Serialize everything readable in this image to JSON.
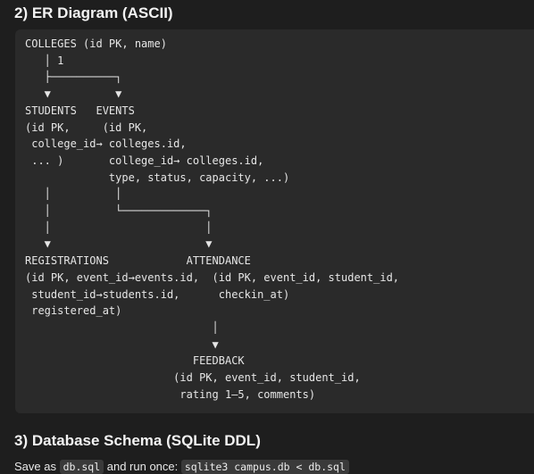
{
  "er_section": {
    "heading": "2) ER Diagram (ASCII)",
    "ascii_lines": [
      "COLLEGES (id PK, name)",
      "   │ 1",
      "   ├──────────┐",
      "   ▼          ▼",
      "STUDENTS   EVENTS",
      "(id PK,     (id PK,",
      " college_id→ colleges.id,",
      " ... )       college_id→ colleges.id,",
      "             type, status, capacity, ...)",
      "   │          │",
      "   │          └─────────────┐",
      "   │                        │",
      "   ▼                        ▼",
      "REGISTRATIONS            ATTENDANCE",
      "(id PK, event_id→events.id,  (id PK, event_id, student_id,",
      " student_id→students.id,      checkin_at)",
      " registered_at)",
      "                             │",
      "                             ▼",
      "                          FEEDBACK",
      "                       (id PK, event_id, student_id,",
      "                        rating 1–5, comments)"
    ]
  },
  "schema_section": {
    "heading": "3) Database Schema (SQLite DDL)",
    "instruction": {
      "prefix": "Save as ",
      "filename": "db.sql",
      "middle": " and run once: ",
      "command": "sqlite3 campus.db < db.sql"
    }
  }
}
